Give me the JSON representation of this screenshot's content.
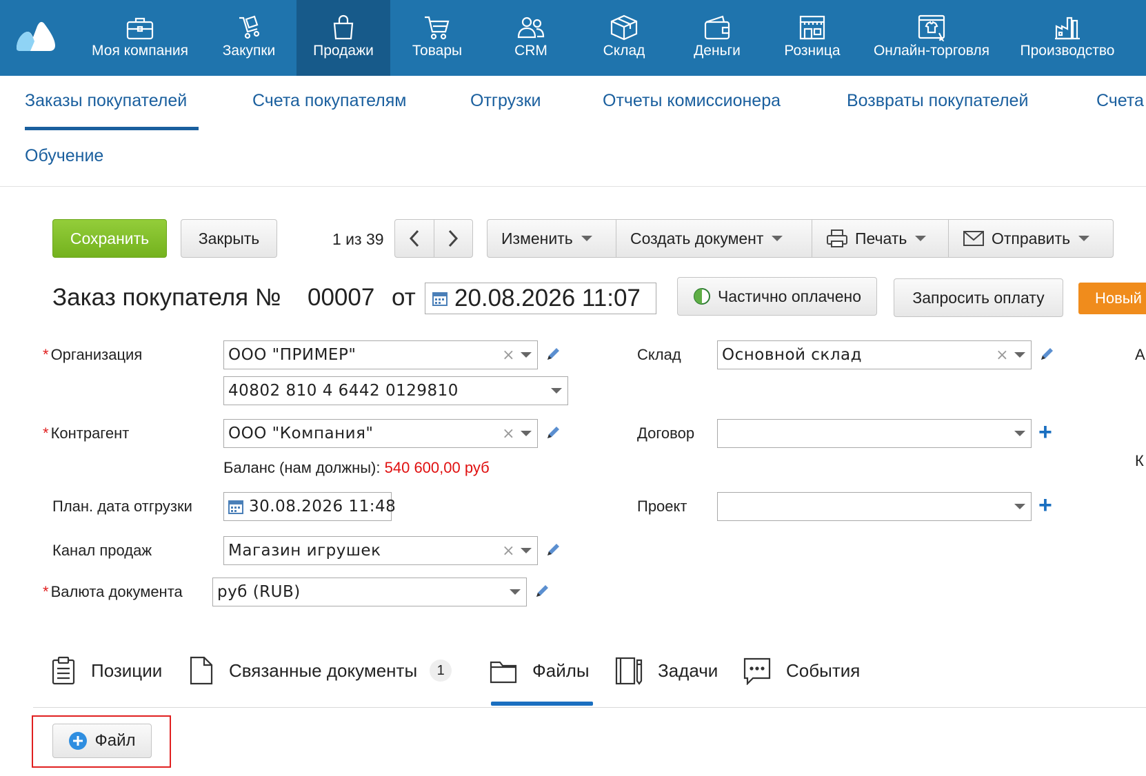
{
  "nav": {
    "items": [
      {
        "label": "Моя компания",
        "icon": "briefcase-icon"
      },
      {
        "label": "Закупки",
        "icon": "cart-hand-icon"
      },
      {
        "label": "Продажи",
        "icon": "shopping-bag-icon",
        "active": true
      },
      {
        "label": "Товары",
        "icon": "cart-icon"
      },
      {
        "label": "CRM",
        "icon": "people-icon"
      },
      {
        "label": "Склад",
        "icon": "box-icon"
      },
      {
        "label": "Деньги",
        "icon": "wallet-icon"
      },
      {
        "label": "Розница",
        "icon": "store-icon"
      },
      {
        "label": "Онлайн-торговля",
        "icon": "online-shop-icon"
      },
      {
        "label": "Производство",
        "icon": "factory-icon"
      }
    ]
  },
  "subnav": {
    "items": [
      "Заказы покупателей",
      "Счета покупателям",
      "Отгрузки",
      "Отчеты комиссионера",
      "Возвраты покупателей",
      "Счета"
    ],
    "second_row": "Обучение",
    "active_index": 0
  },
  "toolbar": {
    "save": "Сохранить",
    "close": "Закрыть",
    "pager": "1 из 39",
    "prev": "‹",
    "next": "›",
    "change": "Изменить",
    "create_doc": "Создать документ",
    "print": "Печать",
    "send": "Отправить"
  },
  "doc": {
    "title": "Заказ покупателя №",
    "number": "00007",
    "from": "от",
    "date": "20.08.2026 11:07",
    "status_payment": "Частично оплачено",
    "request_payment": "Запросить оплату",
    "state": "Новый"
  },
  "form": {
    "required_mark": "*",
    "organization_label": "Организация",
    "organization_value": "ООО \"ПРИМЕР\"",
    "account_value": "40802 810 4 6442 0129810",
    "counterparty_label": "Контрагент",
    "counterparty_value": "ООО \"Компания\"",
    "balance_label": "Баланс (нам должны):",
    "balance_value": "540 600,00 руб",
    "ship_date_label": "План. дата отгрузки",
    "ship_date_value": "30.08.2026 11:48",
    "channel_label": "Канал продаж",
    "channel_value": "Магазин игрушек",
    "currency_label": "Валюта документа",
    "currency_value": "руб (RUB)",
    "warehouse_label": "Склад",
    "warehouse_value": "Основной склад",
    "contract_label": "Договор",
    "contract_value": "",
    "project_label": "Проект",
    "project_value": "",
    "edge_letter_1": "А",
    "edge_letter_2": "К"
  },
  "tabs": {
    "positions": "Позиции",
    "related": "Связанные документы",
    "related_count": "1",
    "files": "Файлы",
    "tasks": "Задачи",
    "events": "События",
    "active": "files"
  },
  "files": {
    "add_button": "Файл"
  },
  "colors": {
    "nav_bg": "#1f74ad",
    "nav_active": "#175a8a",
    "link": "#1a5f9e",
    "save_green": "#7ab923",
    "state_orange": "#f08c1c",
    "balance_red": "#e01010",
    "highlight_red": "#e02020"
  }
}
